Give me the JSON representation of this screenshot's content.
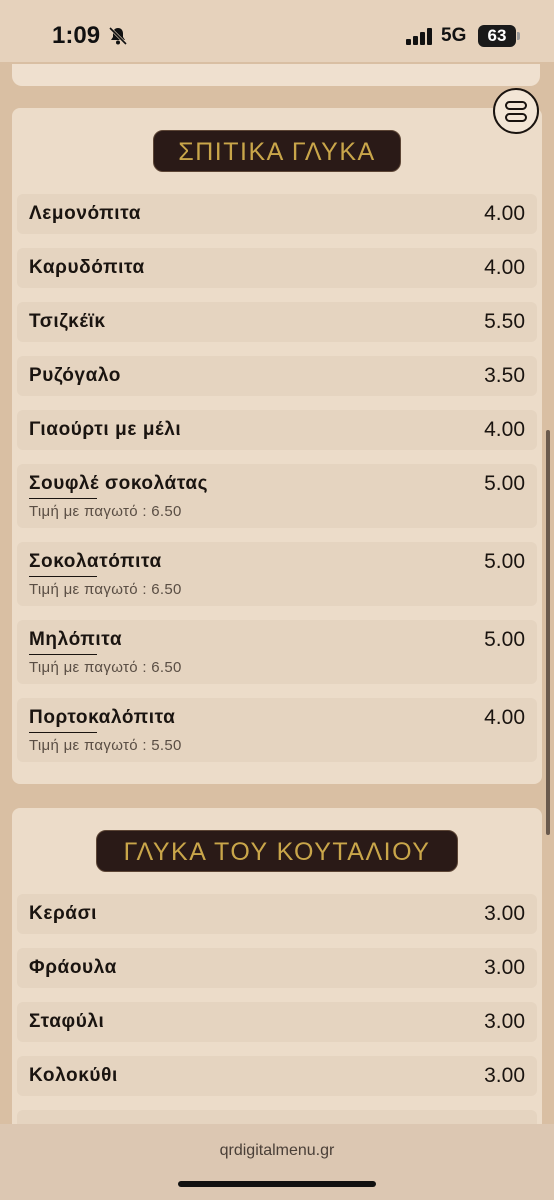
{
  "status_bar": {
    "time": "1:09",
    "network": "5G",
    "battery": "63"
  },
  "sections": [
    {
      "title": "ΣΠΙΤΙΚΑ ΓΛΥΚΑ",
      "items": [
        {
          "name": "Λεμονόπιτα",
          "price": "4.00"
        },
        {
          "name": "Καρυδόπιτα",
          "price": "4.00"
        },
        {
          "name": "Τσιζκέϊκ",
          "price": "5.50"
        },
        {
          "name": "Ρυζόγαλο",
          "price": "3.50"
        },
        {
          "name": "Γιαούρτι με μέλι",
          "price": "4.00"
        },
        {
          "name": "Σουφλέ σοκολάτας",
          "price": "5.00",
          "sub": "Τιμή με παγωτό : 6.50"
        },
        {
          "name": "Σοκολατόπιτα",
          "price": "5.00",
          "sub": "Τιμή με παγωτό : 6.50"
        },
        {
          "name": "Μηλόπιτα",
          "price": "5.00",
          "sub": "Τιμή με παγωτό : 6.50"
        },
        {
          "name": "Πορτοκαλόπιτα",
          "price": "4.00",
          "sub": "Τιμή με παγωτό : 5.50"
        }
      ]
    },
    {
      "title": "ΓΛΥΚΑ ΤΟΥ ΚΟΥΤΑΛΙΟΥ",
      "items": [
        {
          "name": "Κεράσι",
          "price": "3.00"
        },
        {
          "name": "Φράουλα",
          "price": "3.00"
        },
        {
          "name": "Σταφύλι",
          "price": "3.00"
        },
        {
          "name": "Κολοκύθι",
          "price": "3.00"
        }
      ]
    }
  ],
  "footer": {
    "url": "qrdigitalmenu.gr"
  },
  "colors": {
    "page_bg": "#d9bfa3",
    "card_bg": "#ecdcc9",
    "item_bg": "#e5d4c0",
    "title_bg": "#2a1a17",
    "title_text": "#c9a64a"
  },
  "icons": [
    "bell-off-icon",
    "signal-icon",
    "battery-icon",
    "menu-icon"
  ]
}
